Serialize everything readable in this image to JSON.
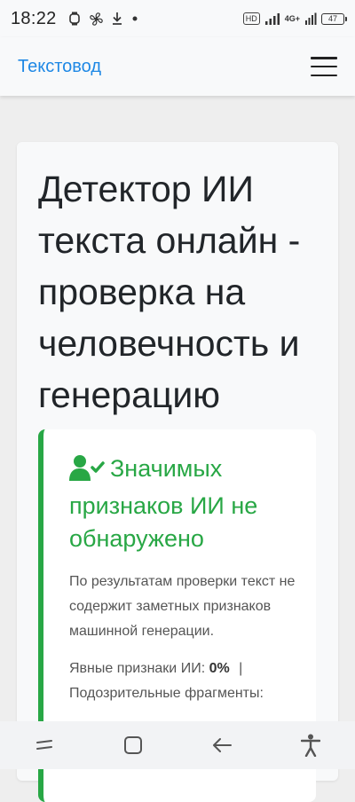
{
  "status_bar": {
    "time": "18:22",
    "hd_label": "HD",
    "network_label": "4G+",
    "battery_level": "47",
    "icons": [
      "watch-icon",
      "fan-icon",
      "download-icon",
      "dot-icon",
      "signal-icon",
      "battery-icon"
    ]
  },
  "navbar": {
    "brand": "Текстовод",
    "menu_icon": "hamburger-icon"
  },
  "main": {
    "title": "Детектор ИИ текста онлайн - проверка на человечность и генерацию"
  },
  "result": {
    "icon": "user-check-icon",
    "title": "Значимых признаков ИИ не обнаружено",
    "description": "По результатам проверки текст не содержит заметных признаков машинной генерации.",
    "explicit_label": "Явные признаки ИИ:",
    "explicit_value": "0%",
    "separator": "|",
    "suspicious_label": "Подозрительные фрагменты:"
  },
  "bottom_nav": {
    "icons": [
      "recents-icon",
      "home-icon",
      "back-icon",
      "accessibility-icon"
    ]
  },
  "colors": {
    "accent_blue": "#1e88e5",
    "success_green": "#28a745"
  }
}
